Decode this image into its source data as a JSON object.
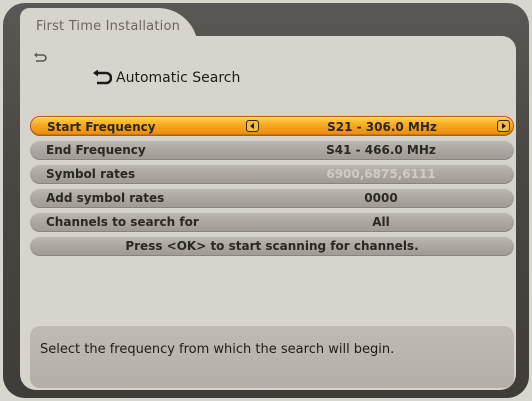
{
  "window": {
    "title": "First Time Installation"
  },
  "section": {
    "title": "Automatic Search"
  },
  "settings": [
    {
      "label": "Start Frequency",
      "value": "S21 - 306.0 MHz",
      "active": true
    },
    {
      "label": "End Frequency",
      "value": "S41 - 466.0 MHz"
    },
    {
      "label": "Symbol rates",
      "value": "6900,6875,6111",
      "faded": true
    },
    {
      "label": "Add symbol rates",
      "value": "0000"
    },
    {
      "label": "Channels to search for",
      "value": "All"
    }
  ],
  "action": {
    "text": "Press <OK> to start scanning for channels."
  },
  "help": {
    "text": "Select the frequency from which the search will begin."
  },
  "colors": {
    "active_row": "#f7a51e",
    "panel": "#d7d4cd",
    "frame": "#4a4744"
  },
  "icons": {
    "back": "back-arrow-icon",
    "section": "section-arrow-icon",
    "left": "arrow-left-icon",
    "right": "arrow-right-icon"
  }
}
